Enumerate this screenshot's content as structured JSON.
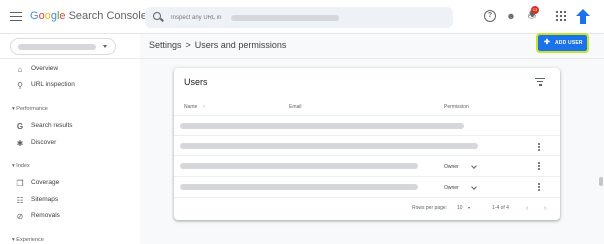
{
  "app": {
    "brand": {
      "g1": "G",
      "g2": "o",
      "g3": "o",
      "g4": "g",
      "g5": "l",
      "g6": "e",
      "rest": " Search Console"
    },
    "brand_colors": {
      "blue": "#4285f4",
      "red": "#ea4335",
      "yellow": "#fbbc05",
      "green": "#34a853"
    }
  },
  "search": {
    "placeholder": "Inspect any URL in",
    "icon": "search-icon"
  },
  "topbar": {
    "notification_count": "13"
  },
  "sidebar": {
    "nav_top": [
      {
        "icon": "home-icon",
        "label": "Overview"
      },
      {
        "icon": "search-icon",
        "label": "URL inspection"
      }
    ],
    "section_performance": "Performance",
    "nav_performance": [
      {
        "icon": "google-g-icon",
        "label": "Search results"
      },
      {
        "icon": "asterisk-icon",
        "label": "Discover"
      }
    ],
    "section_index": "Index",
    "nav_index": [
      {
        "icon": "pages-icon",
        "label": "Coverage"
      },
      {
        "icon": "sitemap-icon",
        "label": "Sitemaps"
      },
      {
        "icon": "removals-icon",
        "label": "Removals"
      }
    ],
    "section_experience": "Experience"
  },
  "header": {
    "breadcrumb_root": "Settings",
    "separator": ">",
    "title": "Users and permissions",
    "add_user": "ADD USER"
  },
  "users_card": {
    "title": "Users",
    "columns": {
      "name": "Name",
      "sort": "↑",
      "email": "Email",
      "permission": "Permission"
    },
    "rows": [
      {
        "permission": ""
      },
      {
        "permission": ""
      },
      {
        "permission": "Owner"
      },
      {
        "permission": "Owner"
      }
    ],
    "footer": {
      "rows_per_page_label": "Rows per page:",
      "rows_per_page": "10",
      "range": "1-4 of 4"
    }
  },
  "colors": {
    "accent": "#1a73e8",
    "highlight": "#c6e52a",
    "notification": "#d93025"
  }
}
